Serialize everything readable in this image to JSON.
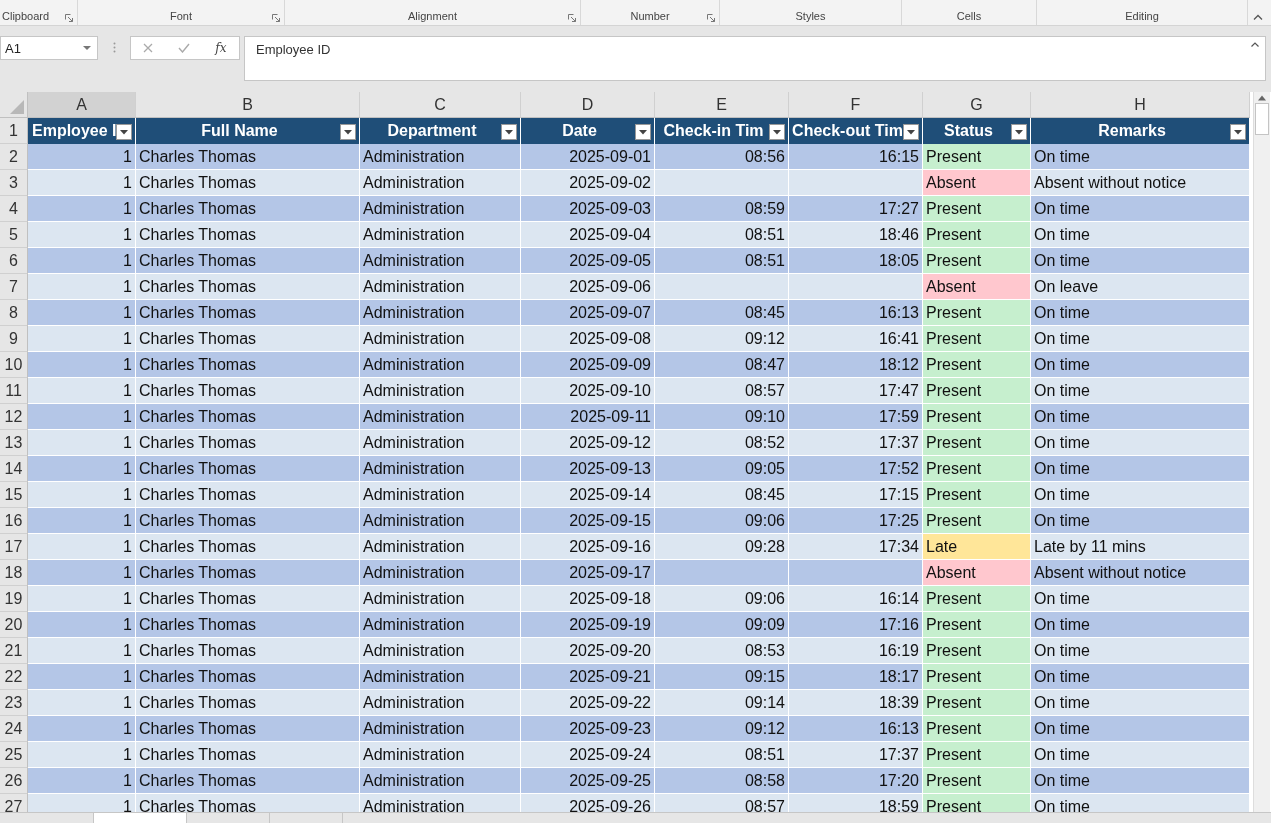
{
  "ribbon": {
    "groups": [
      {
        "label": "Clipboard",
        "launcher": true
      },
      {
        "label": "Font",
        "launcher": true
      },
      {
        "label": "Alignment",
        "launcher": true
      },
      {
        "label": "Number",
        "launcher": true
      },
      {
        "label": "Styles",
        "launcher": false
      },
      {
        "label": "Cells",
        "launcher": false
      },
      {
        "label": "Editing",
        "launcher": false
      }
    ]
  },
  "sheet_tabs": [
    {
      "selected": true
    },
    {
      "selected": false
    },
    {
      "selected": false
    }
  ],
  "formula_bar": {
    "name_box": "A1",
    "function_label": "fx",
    "value": "Employee ID"
  },
  "sheet": {
    "columns": [
      "A",
      "B",
      "C",
      "D",
      "E",
      "F",
      "G",
      "H"
    ],
    "header": {
      "row_number": "1",
      "cells": [
        "Employee I",
        "Full Name",
        "Department",
        "Date",
        "Check-in Tim",
        "Check-out Tim",
        "Status",
        "Remarks"
      ]
    },
    "rows": [
      {
        "row_number": "2",
        "id": "1",
        "name": "Charles Thomas",
        "department": "Administration",
        "date": "2025-09-01",
        "check_in": "08:56",
        "check_out": "16:15",
        "status": "Present",
        "color": "#c6efce",
        "remarks": "On time"
      },
      {
        "row_number": "3",
        "id": "1",
        "name": "Charles Thomas",
        "department": "Administration",
        "date": "2025-09-02",
        "status": "Absent",
        "color": "#ffc7ce",
        "remarks": "Absent without notice"
      },
      {
        "row_number": "4",
        "id": "1",
        "name": "Charles Thomas",
        "department": "Administration",
        "date": "2025-09-03",
        "check_in": "08:59",
        "check_out": "17:27",
        "status": "Present",
        "color": "#c6efce",
        "remarks": "On time"
      },
      {
        "row_number": "5",
        "id": "1",
        "name": "Charles Thomas",
        "department": "Administration",
        "date": "2025-09-04",
        "check_in": "08:51",
        "check_out": "18:46",
        "status": "Present",
        "color": "#c6efce",
        "remarks": "On time"
      },
      {
        "row_number": "6",
        "id": "1",
        "name": "Charles Thomas",
        "department": "Administration",
        "date": "2025-09-05",
        "check_in": "08:51",
        "check_out": "18:05",
        "status": "Present",
        "color": "#c6efce",
        "remarks": "On time"
      },
      {
        "row_number": "7",
        "id": "1",
        "name": "Charles Thomas",
        "department": "Administration",
        "date": "2025-09-06",
        "status": "Absent",
        "color": "#ffc7ce",
        "remarks": "On leave"
      },
      {
        "row_number": "8",
        "id": "1",
        "name": "Charles Thomas",
        "department": "Administration",
        "date": "2025-09-07",
        "check_in": "08:45",
        "check_out": "16:13",
        "status": "Present",
        "color": "#c6efce",
        "remarks": "On time"
      },
      {
        "row_number": "9",
        "id": "1",
        "name": "Charles Thomas",
        "department": "Administration",
        "date": "2025-09-08",
        "check_in": "09:12",
        "check_out": "16:41",
        "status": "Present",
        "color": "#c6efce",
        "remarks": "On time"
      },
      {
        "row_number": "10",
        "id": "1",
        "name": "Charles Thomas",
        "department": "Administration",
        "date": "2025-09-09",
        "check_in": "08:47",
        "check_out": "18:12",
        "status": "Present",
        "color": "#c6efce",
        "remarks": "On time"
      },
      {
        "row_number": "11",
        "id": "1",
        "name": "Charles Thomas",
        "department": "Administration",
        "date": "2025-09-10",
        "check_in": "08:57",
        "check_out": "17:47",
        "status": "Present",
        "color": "#c6efce",
        "remarks": "On time"
      },
      {
        "row_number": "12",
        "id": "1",
        "name": "Charles Thomas",
        "department": "Administration",
        "date": "2025-09-11",
        "check_in": "09:10",
        "check_out": "17:59",
        "status": "Present",
        "color": "#c6efce",
        "remarks": "On time"
      },
      {
        "row_number": "13",
        "id": "1",
        "name": "Charles Thomas",
        "department": "Administration",
        "date": "2025-09-12",
        "check_in": "08:52",
        "check_out": "17:37",
        "status": "Present",
        "color": "#c6efce",
        "remarks": "On time"
      },
      {
        "row_number": "14",
        "id": "1",
        "name": "Charles Thomas",
        "department": "Administration",
        "date": "2025-09-13",
        "check_in": "09:05",
        "check_out": "17:52",
        "status": "Present",
        "color": "#c6efce",
        "remarks": "On time"
      },
      {
        "row_number": "15",
        "id": "1",
        "name": "Charles Thomas",
        "department": "Administration",
        "date": "2025-09-14",
        "check_in": "08:45",
        "check_out": "17:15",
        "status": "Present",
        "color": "#c6efce",
        "remarks": "On time"
      },
      {
        "row_number": "16",
        "id": "1",
        "name": "Charles Thomas",
        "department": "Administration",
        "date": "2025-09-15",
        "check_in": "09:06",
        "check_out": "17:25",
        "status": "Present",
        "color": "#c6efce",
        "remarks": "On time"
      },
      {
        "row_number": "17",
        "id": "1",
        "name": "Charles Thomas",
        "department": "Administration",
        "date": "2025-09-16",
        "check_in": "09:28",
        "check_out": "17:34",
        "status": "Late",
        "color": "#ffe699",
        "remarks": "Late by 11 mins"
      },
      {
        "row_number": "18",
        "id": "1",
        "name": "Charles Thomas",
        "department": "Administration",
        "date": "2025-09-17",
        "status": "Absent",
        "color": "#ffc7ce",
        "remarks": "Absent without notice"
      },
      {
        "row_number": "19",
        "id": "1",
        "name": "Charles Thomas",
        "department": "Administration",
        "date": "2025-09-18",
        "check_in": "09:06",
        "check_out": "16:14",
        "status": "Present",
        "color": "#c6efce",
        "remarks": "On time"
      },
      {
        "row_number": "20",
        "id": "1",
        "name": "Charles Thomas",
        "department": "Administration",
        "date": "2025-09-19",
        "check_in": "09:09",
        "check_out": "17:16",
        "status": "Present",
        "color": "#c6efce",
        "remarks": "On time"
      },
      {
        "row_number": "21",
        "id": "1",
        "name": "Charles Thomas",
        "department": "Administration",
        "date": "2025-09-20",
        "check_in": "08:53",
        "check_out": "16:19",
        "status": "Present",
        "color": "#c6efce",
        "remarks": "On time"
      },
      {
        "row_number": "22",
        "id": "1",
        "name": "Charles Thomas",
        "department": "Administration",
        "date": "2025-09-21",
        "check_in": "09:15",
        "check_out": "18:17",
        "status": "Present",
        "color": "#c6efce",
        "remarks": "On time"
      },
      {
        "row_number": "23",
        "id": "1",
        "name": "Charles Thomas",
        "department": "Administration",
        "date": "2025-09-22",
        "check_in": "09:14",
        "check_out": "18:39",
        "status": "Present",
        "color": "#c6efce",
        "remarks": "On time"
      },
      {
        "row_number": "24",
        "id": "1",
        "name": "Charles Thomas",
        "department": "Administration",
        "date": "2025-09-23",
        "check_in": "09:12",
        "check_out": "16:13",
        "status": "Present",
        "color": "#c6efce",
        "remarks": "On time"
      },
      {
        "row_number": "25",
        "id": "1",
        "name": "Charles Thomas",
        "department": "Administration",
        "date": "2025-09-24",
        "check_in": "08:51",
        "check_out": "17:37",
        "status": "Present",
        "color": "#c6efce",
        "remarks": "On time"
      },
      {
        "row_number": "26",
        "id": "1",
        "name": "Charles Thomas",
        "department": "Administration",
        "date": "2025-09-25",
        "check_in": "08:58",
        "check_out": "17:20",
        "status": "Present",
        "color": "#c6efce",
        "remarks": "On time"
      },
      {
        "row_number": "27",
        "id": "1",
        "name": "Charles Thomas",
        "department": "Administration",
        "date": "2025-09-26",
        "check_in": "08:57",
        "check_out": "18:59",
        "status": "Present",
        "color": "#c6efce",
        "remarks": "On time"
      }
    ]
  }
}
